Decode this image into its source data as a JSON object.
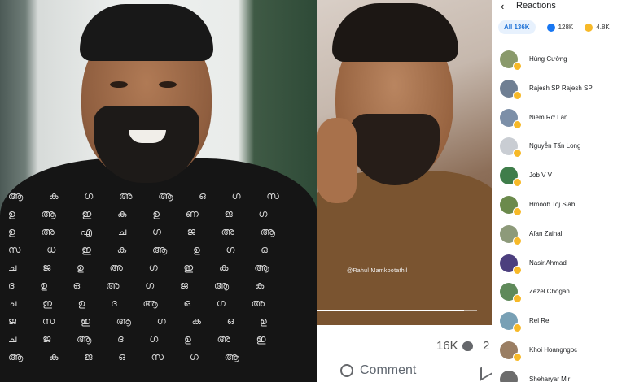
{
  "photo_left": {
    "shirt_glyphs": "ആ ക ഗ അ ആ ഒ ഗ സ ഉ ആ ഇ ക ഉ ണ ജ ഗ ഉ അ എ ച ഗ ജ അ ആ സ ധ ഇ ക ആ ഉ ഗ ഒ ച ജ ഉ അ ഗ ഇ ക ആ ദ ഉ ഒ അ ഗ ജ ആ ക ച ഇ ഉ ദ ആ ഒ ഗ അ ജ സ ഇ ആ ഗ ക ഒ ഉ ച ജ ആ ദ ഗ ഉ അ ഇ ആ ക ജ ഒ സ ഗ ആ"
  },
  "video": {
    "watermark": "@Rahul Mamkootathil",
    "progress": 0.92
  },
  "bottom_bar": {
    "comment_count": "16K",
    "share_count": "2",
    "comment_label": "Comment"
  },
  "reactions": {
    "title": "Reactions",
    "tabs": {
      "all": "All 136K",
      "like": "128K",
      "haha": "4.8K"
    },
    "colors": {
      "accent": "#1a6fd6",
      "like": "#1877f2",
      "haha": "#f7b928"
    },
    "people": [
      {
        "name": "Hùng Cường",
        "avatar_color": "#8a9a6b"
      },
      {
        "name": "Rajesh SP Rajesh SP",
        "avatar_color": "#6f7f93"
      },
      {
        "name": "Niêm Rơ Lan",
        "avatar_color": "#7c8fa8"
      },
      {
        "name": "Nguyễn Tấn Long",
        "avatar_color": "#c9cdd3"
      },
      {
        "name": "Job V V",
        "avatar_color": "#3f7d4a"
      },
      {
        "name": "Hmoob Toj Siab",
        "avatar_color": "#6b8a4c"
      },
      {
        "name": "Afan Zainal",
        "avatar_color": "#8d9a7a"
      },
      {
        "name": "Nasir Ahmad",
        "avatar_color": "#4c3f7e"
      },
      {
        "name": "Zezel Chogan",
        "avatar_color": "#5f8a5a"
      },
      {
        "name": "Rel Rel",
        "avatar_color": "#78a0b5"
      },
      {
        "name": "Khoi Hoangngoc",
        "avatar_color": "#9a7e63"
      },
      {
        "name": "Sheharyar Mir",
        "avatar_color": "#6c6c6c"
      }
    ]
  }
}
